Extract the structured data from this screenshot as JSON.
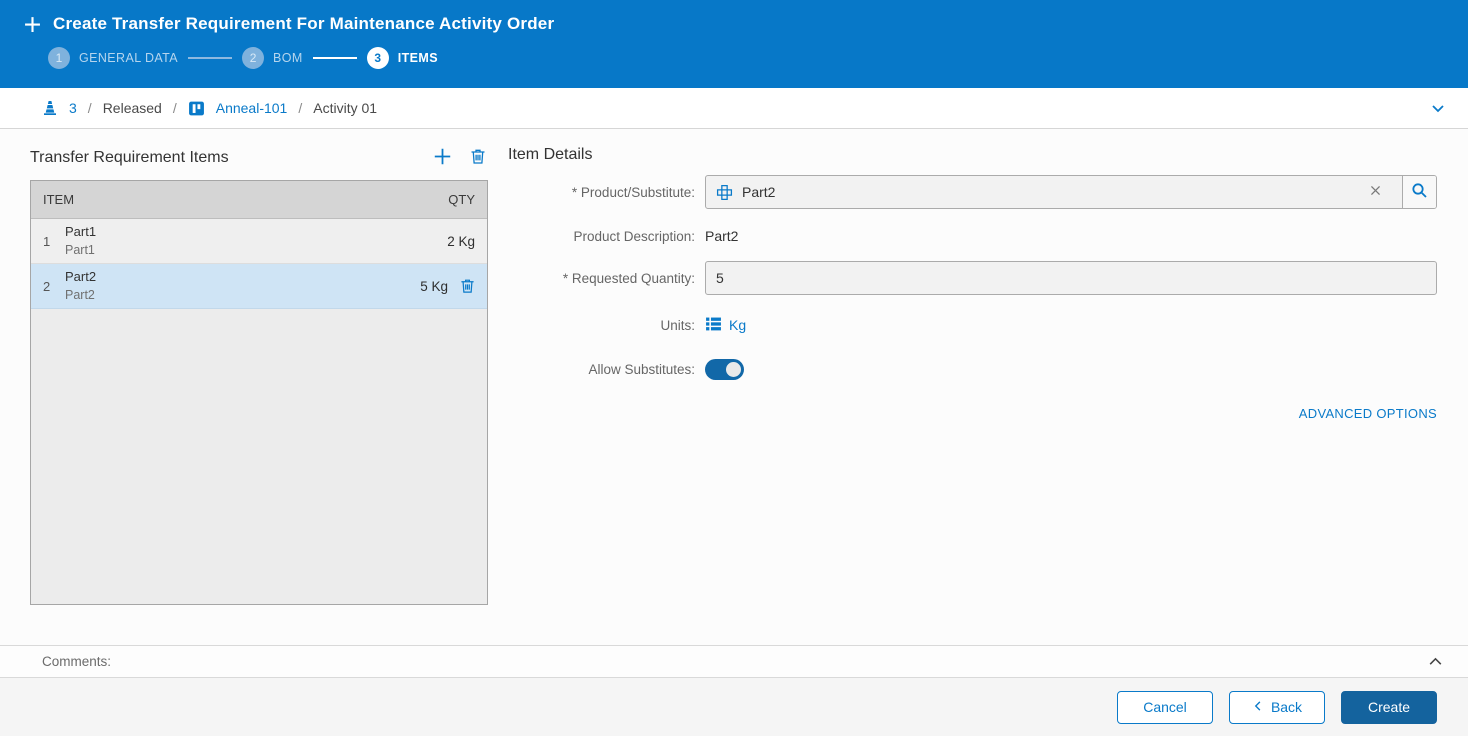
{
  "header": {
    "title": "Create Transfer Requirement For Maintenance Activity Order",
    "steps": [
      {
        "number": "1",
        "label": "GENERAL DATA"
      },
      {
        "number": "2",
        "label": "BOM"
      },
      {
        "number": "3",
        "label": "ITEMS"
      }
    ]
  },
  "breadcrumb": {
    "count": "3",
    "separator": "/",
    "status": "Released",
    "resource": "Anneal-101",
    "activity": "Activity 01"
  },
  "items_panel": {
    "title": "Transfer Requirement Items",
    "columns": {
      "item": "ITEM",
      "qty": "QTY"
    },
    "rows": [
      {
        "index": "1",
        "name": "Part1",
        "description": "Part1",
        "qty": "2 Kg"
      },
      {
        "index": "2",
        "name": "Part2",
        "description": "Part2",
        "qty": "5 Kg"
      }
    ]
  },
  "details": {
    "title": "Item Details",
    "product": {
      "label": "* Product/Substitute:",
      "value": "Part2"
    },
    "description": {
      "label": "Product Description:",
      "value": "Part2"
    },
    "quantity": {
      "label": "* Requested Quantity:",
      "value": "5"
    },
    "units": {
      "label": "Units:",
      "value": "Kg"
    },
    "substitutes": {
      "label": "Allow Substitutes:",
      "state": "on"
    },
    "advanced_options": "ADVANCED OPTIONS"
  },
  "comments": {
    "label": "Comments:"
  },
  "footer": {
    "cancel": "Cancel",
    "back": "Back",
    "create": "Create"
  },
  "colors": {
    "header_blue": "#0778c8",
    "link_blue": "#0a7ac9",
    "primary_button_blue": "#14639e",
    "selected_row_blue": "#cfe4f5",
    "table_header_gray": "#d5d5d5"
  },
  "icons": {
    "add": "plus-icon",
    "delete": "trash-icon",
    "order": "cone-icon",
    "resource": "resource-icon",
    "product": "product-grid-icon",
    "clear": "x-icon",
    "search": "magnifier-icon",
    "units": "list-icon",
    "expand": "chevron-down-icon",
    "collapse": "chevron-up-icon",
    "back": "chevron-left-icon"
  }
}
